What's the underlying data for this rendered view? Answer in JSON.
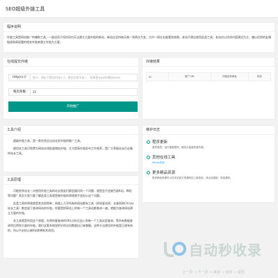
{
  "header": {
    "title": "SEO超级外链工具"
  },
  "program": {
    "heading": "程序说明",
    "text": "外链工具是网站推广的辅助工具，一般适用于短时间内无法建立大量外链的新站，新站应坚持每天做一到两次为宜，大约一周左右能看到效果。老站不建议使用此类工具，老站应以优质内容建设为主，辅以优质的友情链接和高权重的相关外链来建立外链为主要。"
  },
  "form": {
    "heading": "在线提交外链",
    "url_label": "http(s)://",
    "url_placeholder": "提示：网址不要加https://，域名后面不加 / ，如果是www的需加www",
    "count_label": "每页条数",
    "count_value": "15",
    "submit_label": "开始推广"
  },
  "results": {
    "heading": "外链结果",
    "columns": [
      "ID",
      "推广URL",
      "外链目标网址",
      "状态"
    ]
  },
  "intro": {
    "heading": "工具介绍",
    "paragraphs": [
      "超级外链工具，是一款在线全自动化发外链的推广工具。",
      "使用本工具可免费为网站在线批量增加外链，大大提高外链发布工作效率，是广大草根站长们必备的站长工具。"
    ]
  },
  "principle": {
    "heading": "工具原理",
    "paragraphs": [
      "可能很多站长一次使用外链工具的站长朋友们都会疑问同一个问题，就是会不会被百度K站，降权等问题？其实大家只要了解此类工具就是做外链的原理就不会担心这个问题。",
      "此类工具的原理就是其实很简单，网络上几乎所有的网站都有工具（例如爱站网、去查网和Chinaz站长工具）都会留下查询网站的外链，你要是把网站上的每一个工具站都查询一遍，就能为查询网站建立大量的外链。",
      "本工具就是利用这个原理，先将你要查询的URL分析后加入到每一个工具站里查询，等所有数据查询完后得到大量的外链，我们这套系统里把它的访问数量自己来掌握。这种方法建设的外链是正规有效的，所以不必担心被K站和降权的风险。"
    ]
  },
  "updates": {
    "heading": "维护日志",
    "items": [
      {
        "title": "程序更新",
        "sub": "重构底层，运行速度更快，增加大量高权重外链。"
      },
      {
        "title": "其他在线工具",
        "link": "Whois查询"
      },
      {
        "title": "更多精品资源",
        "sub": "更多精品资源可以在本站官方资源网站上能找到，请点此链接：官者源码。"
      }
    ]
  },
  "watermark": {
    "big": "自动秒收录",
    "small": "上一页 → 下一页 → 来访 → 访问 → 返回"
  },
  "colors": {
    "accent": "#009688",
    "link": "#1e9fff"
  }
}
